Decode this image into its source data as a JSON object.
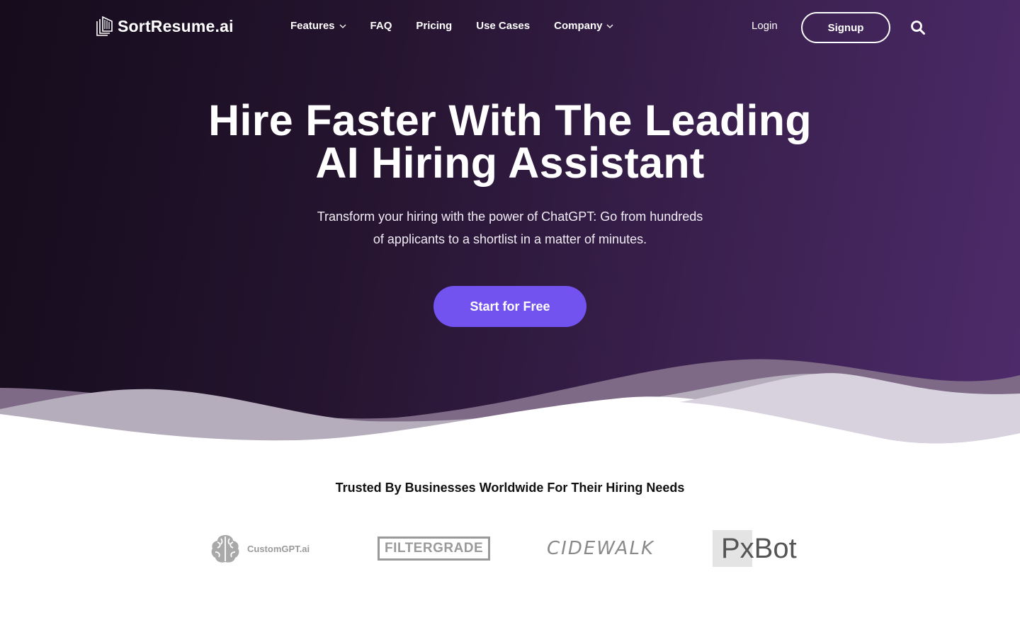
{
  "brand": {
    "name": "SortResume.ai",
    "icon": "stacked-pages-logo-icon"
  },
  "nav": {
    "items": [
      {
        "label": "Features",
        "has_dropdown": true
      },
      {
        "label": "FAQ",
        "has_dropdown": false
      },
      {
        "label": "Pricing",
        "has_dropdown": false
      },
      {
        "label": "Use Cases",
        "has_dropdown": false
      },
      {
        "label": "Company",
        "has_dropdown": true
      }
    ],
    "login_label": "Login",
    "signup_label": "Signup",
    "search_icon": "search-icon"
  },
  "hero": {
    "headline_line1": "Hire Faster With The Leading",
    "headline_line2": "AI Hiring Assistant",
    "subtext_line1": "Transform your hiring with the power of ChatGPT: Go from hundreds",
    "subtext_line2": "of applicants to a shortlist in a matter of minutes.",
    "cta_label": "Start for Free"
  },
  "trust": {
    "heading": "Trusted By Businesses Worldwide For Their Hiring Needs",
    "logos": [
      "CustomGPT.ai",
      "FILTERGRADE",
      "CIDEWALK",
      "PxBot"
    ]
  },
  "colors": {
    "hero_dark": "#150c1c",
    "hero_purple": "#4e2b6b",
    "cta": "#7353f0",
    "text_white": "#ffffff"
  }
}
